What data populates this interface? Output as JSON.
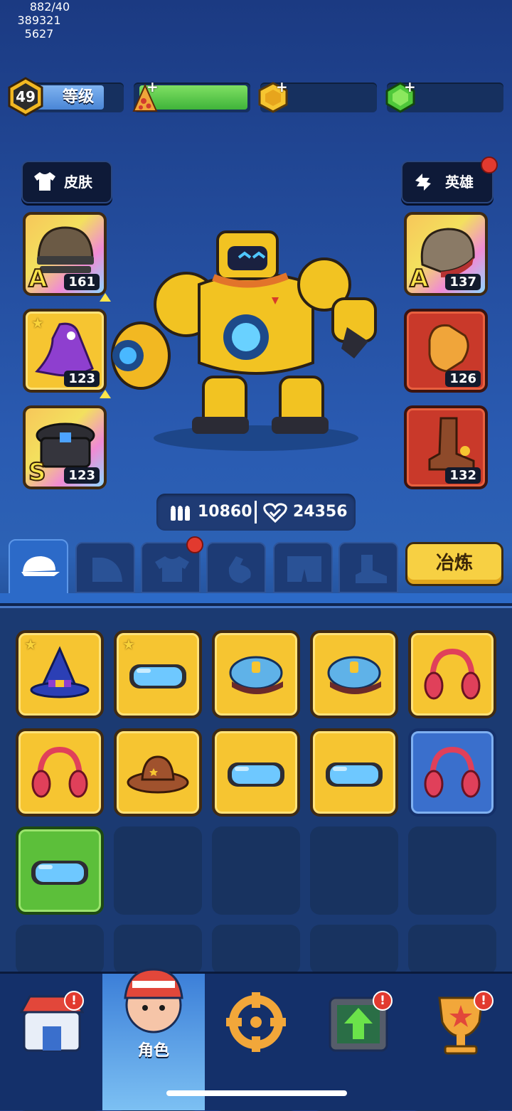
{
  "top_bar": {
    "level": {
      "value": "49",
      "label": "等级"
    },
    "energy": {
      "value": "882/40"
    },
    "coins": {
      "value": "389321"
    },
    "gems": {
      "value": "5627"
    }
  },
  "side_buttons": {
    "skin_label": "皮肤",
    "hero_label": "英雄"
  },
  "equipped_left": [
    {
      "name": "helmet",
      "level": "161",
      "grade": "A"
    },
    {
      "name": "cloak",
      "level": "123",
      "grade": ""
    },
    {
      "name": "belt",
      "level": "123",
      "grade": "S"
    }
  ],
  "equipped_right": [
    {
      "name": "armor-cap",
      "level": "137",
      "grade": "A"
    },
    {
      "name": "glove",
      "level": "126",
      "grade": ""
    },
    {
      "name": "boot",
      "level": "132",
      "grade": ""
    }
  ],
  "stats": {
    "attack": "10860",
    "health": "24356"
  },
  "tabs": [
    "hat",
    "shoulder",
    "shirt",
    "glove",
    "pants",
    "boot"
  ],
  "smelt_label": "冶炼",
  "inventory": [
    {
      "icon": "wizard-hat-icon",
      "rarity": "gold",
      "star": true
    },
    {
      "icon": "goggles-icon",
      "rarity": "gold",
      "star": true
    },
    {
      "icon": "police-cap-icon",
      "rarity": "gold",
      "star": false
    },
    {
      "icon": "police-cap-icon",
      "rarity": "gold",
      "star": false
    },
    {
      "icon": "headphones-icon",
      "rarity": "gold",
      "star": false
    },
    {
      "icon": "headphones-icon",
      "rarity": "gold",
      "star": false
    },
    {
      "icon": "cowboy-hat-icon",
      "rarity": "gold",
      "star": false
    },
    {
      "icon": "goggles-icon",
      "rarity": "gold",
      "star": false
    },
    {
      "icon": "goggles-icon",
      "rarity": "gold",
      "star": false
    },
    {
      "icon": "headphones-icon",
      "rarity": "blue",
      "star": false
    },
    {
      "icon": "goggles-icon",
      "rarity": "green",
      "star": false
    }
  ],
  "bottom_nav": {
    "character_label": "角色"
  },
  "colors": {
    "gold": "#f6c531",
    "blue": "#3a6fcc",
    "green": "#5cbf3a",
    "red": "#c9392a",
    "badge": "#e23a2f"
  }
}
